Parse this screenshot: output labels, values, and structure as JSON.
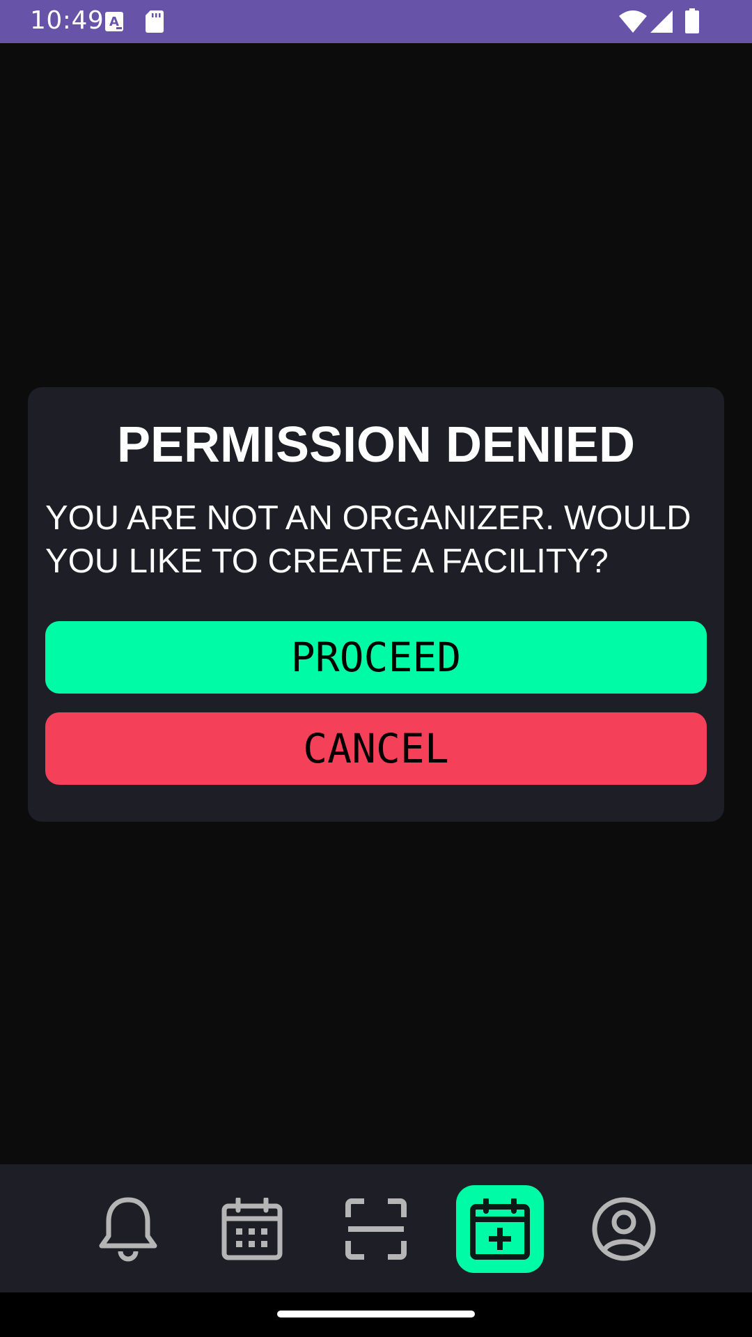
{
  "status_bar": {
    "time": "10:49",
    "icons": [
      "a-notification-icon",
      "sd-card-icon",
      "wifi-icon",
      "cell-signal-icon",
      "battery-icon"
    ],
    "background": "#6753a8"
  },
  "dialog": {
    "title": "PERMISSION DENIED",
    "message": "YOU ARE NOT AN ORGANIZER. WOULD YOU LIKE TO CREATE A FACILITY?",
    "proceed_label": "PROCEED",
    "cancel_label": "CANCEL",
    "colors": {
      "background": "#1e1e27",
      "proceed": "#00fba7",
      "cancel": "#f5405a"
    }
  },
  "bottom_nav": {
    "items": [
      {
        "icon": "bell-icon",
        "active": false
      },
      {
        "icon": "calendar-icon",
        "active": false
      },
      {
        "icon": "scan-icon",
        "active": false
      },
      {
        "icon": "calendar-add-icon",
        "active": true
      },
      {
        "icon": "profile-icon",
        "active": false
      }
    ],
    "colors": {
      "background": "#1e1e27",
      "active": "#00fba7",
      "inactive_icon": "#b5b5b5"
    }
  }
}
